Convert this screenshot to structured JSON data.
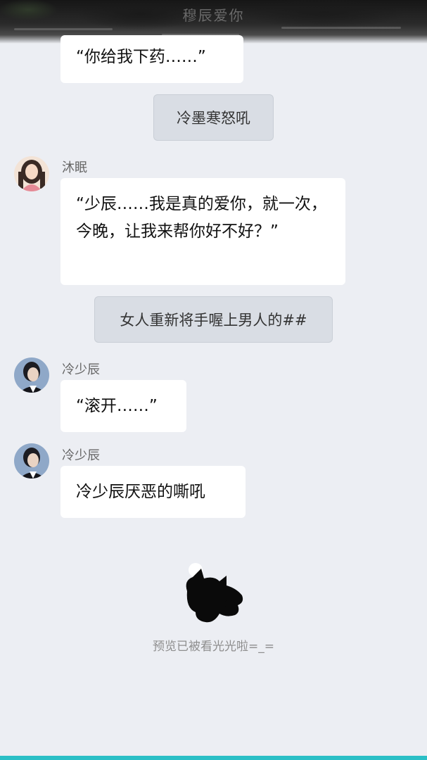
{
  "header": {
    "title": "穆辰爱你"
  },
  "messages": [
    {
      "type": "bubble",
      "text": "“你给我下药……”"
    },
    {
      "type": "narration",
      "text": "冷墨寒怒吼"
    },
    {
      "type": "speaker",
      "name": "沐眠",
      "avatar": "female-avatar"
    },
    {
      "type": "bubble",
      "text": "“少辰……我是真的爱你，就一次，今晚，让我来帮你好不好？”"
    },
    {
      "type": "narration",
      "text": "女人重新将手喔上男人的##"
    },
    {
      "type": "speaker",
      "name": "冷少辰",
      "avatar": "male-avatar"
    },
    {
      "type": "bubble",
      "text": "“滚开……”"
    },
    {
      "type": "speaker",
      "name": "冷少辰",
      "avatar": "male-avatar"
    },
    {
      "type": "bubble",
      "text": "冷少辰厌恶的嘶吼"
    }
  ],
  "footer": {
    "text": "预览已被看光光啦=_=",
    "icon": "sleeping-cat-icon"
  },
  "colors": {
    "background": "#eceef3",
    "bubble": "#ffffff",
    "narration": "#d9dde4",
    "accent": "#2bbfc6"
  }
}
